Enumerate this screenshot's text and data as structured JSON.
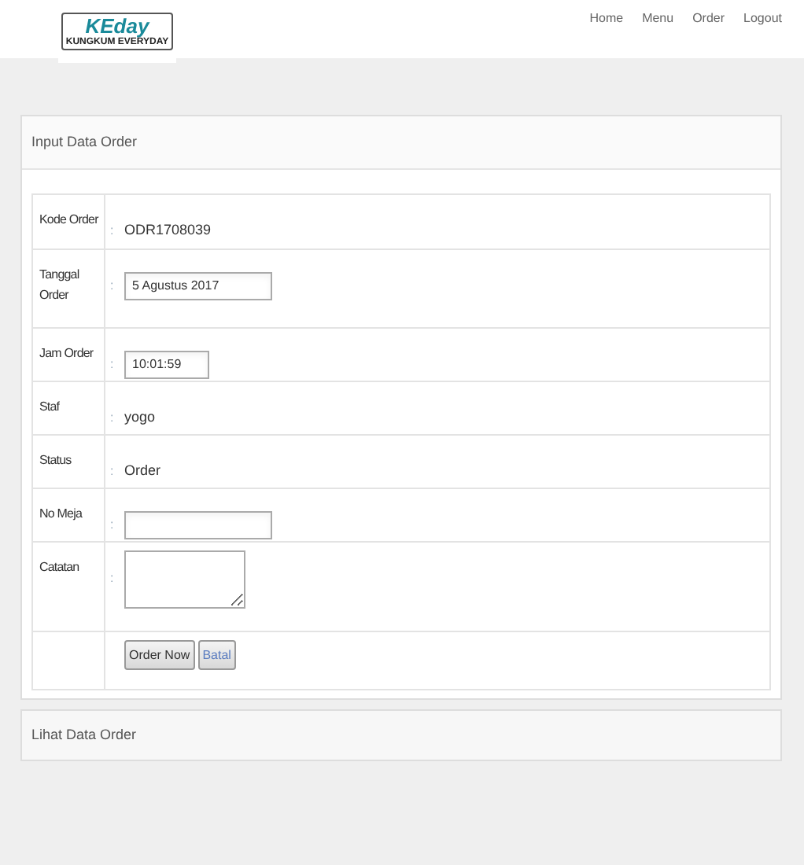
{
  "logo": {
    "brand": "KEday",
    "tagline": "KUNGKUM EVERYDAY"
  },
  "nav": [
    "Home",
    "Menu",
    "Order",
    "Logout"
  ],
  "input_panel": {
    "title": "Input Data Order",
    "rows": [
      {
        "kind": "text",
        "label": "Kode Order",
        "separator": ":",
        "value": "ODR1708039"
      },
      {
        "kind": "input",
        "label": "Tanggal Order",
        "separator": ":",
        "value": "5 Agustus 2017"
      },
      {
        "kind": "shortinput",
        "label": "Jam Order",
        "separator": ":",
        "value": "10:01:59"
      },
      {
        "kind": "text",
        "label": "Staf",
        "separator": ":",
        "value": "yogo"
      },
      {
        "kind": "text",
        "label": "Status",
        "separator": ":",
        "value": "Order"
      },
      {
        "kind": "input",
        "label": "No Meja",
        "separator": ":",
        "value": ""
      },
      {
        "kind": "textarea",
        "label": "Catatan",
        "separator": ":"
      },
      {
        "kind": "buttons",
        "buttons": [
          "Order Now",
          "Batal"
        ]
      }
    ]
  },
  "list_panel": {
    "title": "Lihat Data Order"
  }
}
